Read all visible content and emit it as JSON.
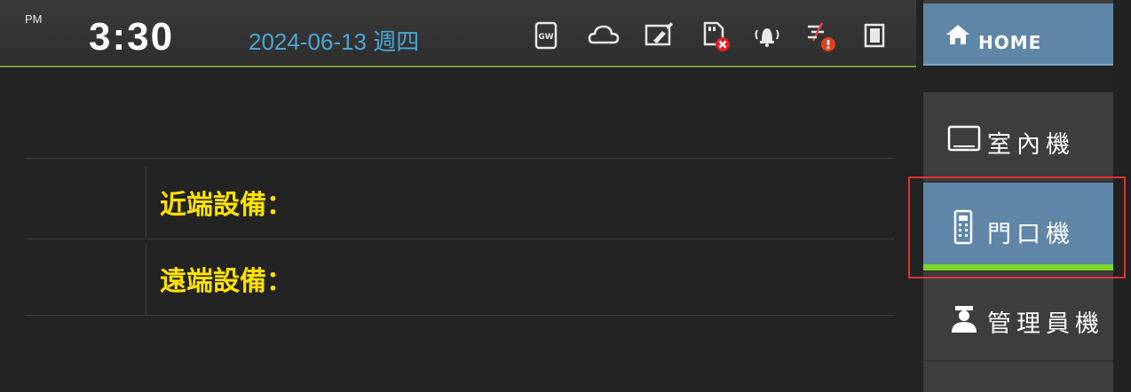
{
  "status_bar": {
    "ampm": "PM",
    "time": "3:30",
    "date": "2024-06-13 週四",
    "icons": [
      "gateway-icon",
      "cloud-icon",
      "screen-clean-icon",
      "sd-card-error-icon",
      "alarm-bell-icon",
      "network-error-icon",
      "door-icon"
    ],
    "gateway_text": "GW"
  },
  "nav": {
    "home_label": "HOME",
    "items": [
      {
        "label": "室內機",
        "icon": "indoor-monitor-icon"
      },
      {
        "label": "門口機",
        "icon": "door-station-icon",
        "active": true
      },
      {
        "label": "管理員機",
        "icon": "guard-icon"
      }
    ]
  },
  "content": {
    "rows": [
      {
        "label": "近端設備："
      },
      {
        "label": "遠端設備："
      }
    ]
  },
  "colors": {
    "accent_blue": "#5f86a6",
    "date_blue": "#4aa6d6",
    "label_yellow": "#ffe100",
    "active_underline": "#7bd82a",
    "highlight_red": "#e03131"
  }
}
